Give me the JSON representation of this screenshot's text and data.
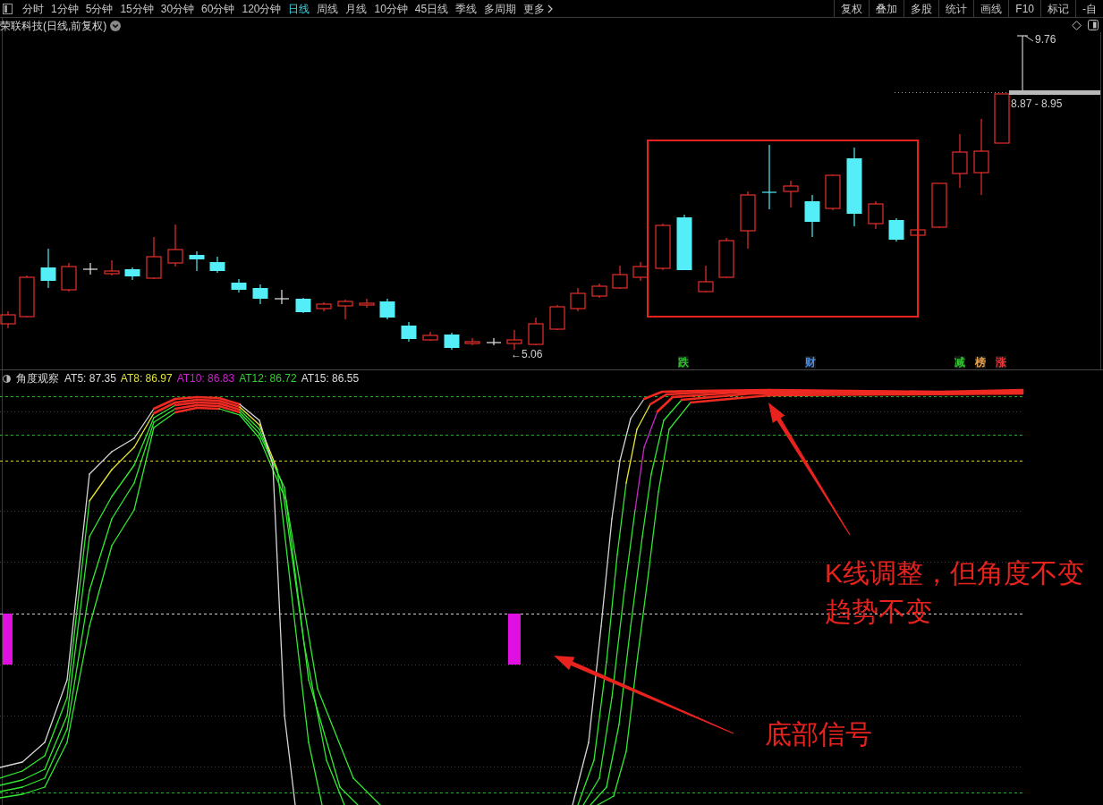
{
  "toolbar": {
    "periods": [
      {
        "label": "分时",
        "selected": false
      },
      {
        "label": "1分钟",
        "selected": false
      },
      {
        "label": "5分钟",
        "selected": false
      },
      {
        "label": "15分钟",
        "selected": false
      },
      {
        "label": "30分钟",
        "selected": false
      },
      {
        "label": "60分钟",
        "selected": false
      },
      {
        "label": "120分钟",
        "selected": false
      },
      {
        "label": "日线",
        "selected": true
      },
      {
        "label": "周线",
        "selected": false
      },
      {
        "label": "月线",
        "selected": false
      },
      {
        "label": "10分钟",
        "selected": false
      },
      {
        "label": "45日线",
        "selected": false
      },
      {
        "label": "季线",
        "selected": false
      },
      {
        "label": "多周期",
        "selected": false
      }
    ],
    "more_button": {
      "label": "更多"
    },
    "tools": [
      "复权",
      "叠加",
      "多股",
      "统计",
      "画线",
      "F10",
      "标记",
      "-自"
    ]
  },
  "chart": {
    "title": "荣联科技(日线,前复权)",
    "high_label": "9.76",
    "range_label": "8.87 - 8.95",
    "low_label": "←5.06",
    "signals": [
      {
        "label": "跌",
        "color": "#2ec82e"
      },
      {
        "label": "财",
        "color": "#4a8ee8"
      },
      {
        "label": "减",
        "color": "#2ec82e"
      },
      {
        "label": "榜",
        "color": "#e8a050"
      },
      {
        "label": "涨",
        "color": "#e83838"
      }
    ]
  },
  "indicator": {
    "title": "角度观察",
    "values": [
      {
        "label": "AT5: 87.35",
        "color": "#dcdcdc"
      },
      {
        "label": "AT8: 86.97",
        "color": "#e0e040"
      },
      {
        "label": "AT10: 86.83",
        "color": "#d020d0"
      },
      {
        "label": "AT12: 86.72",
        "color": "#30d030"
      },
      {
        "label": "AT15: 86.55",
        "color": "#dcdcdc"
      }
    ]
  },
  "annotations": [
    {
      "lines": [
        "K线调整，但角度不变",
        "趋势不变"
      ]
    },
    {
      "lines": [
        "底部信号"
      ]
    }
  ]
}
